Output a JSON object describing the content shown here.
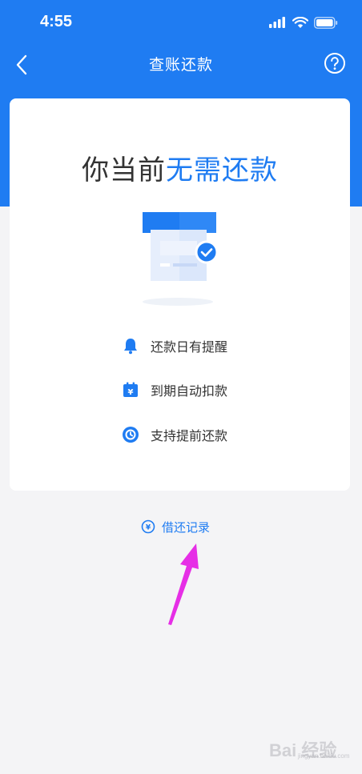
{
  "status_bar": {
    "time": "4:55"
  },
  "nav": {
    "title": "查账还款",
    "back_icon": "chevron-left-icon",
    "help_icon": "question-circle-icon"
  },
  "card": {
    "headline_prefix": "你当前",
    "headline_highlight": "无需还款",
    "features": [
      {
        "icon": "bell-icon",
        "label": "还款日有提醒"
      },
      {
        "icon": "calendar-yen-icon",
        "label": "到期自动扣款"
      },
      {
        "icon": "clock-icon",
        "label": "支持提前还款"
      }
    ]
  },
  "record_link": {
    "label": "借还记录",
    "icon": "yen-circle-icon"
  },
  "watermark": {
    "text": "Bai 经验",
    "sub": "jingyan.baidu.com"
  },
  "colors": {
    "primary": "#1f7cf2",
    "background": "#f4f4f6",
    "card": "#ffffff",
    "arrow": "#e62ee6"
  }
}
